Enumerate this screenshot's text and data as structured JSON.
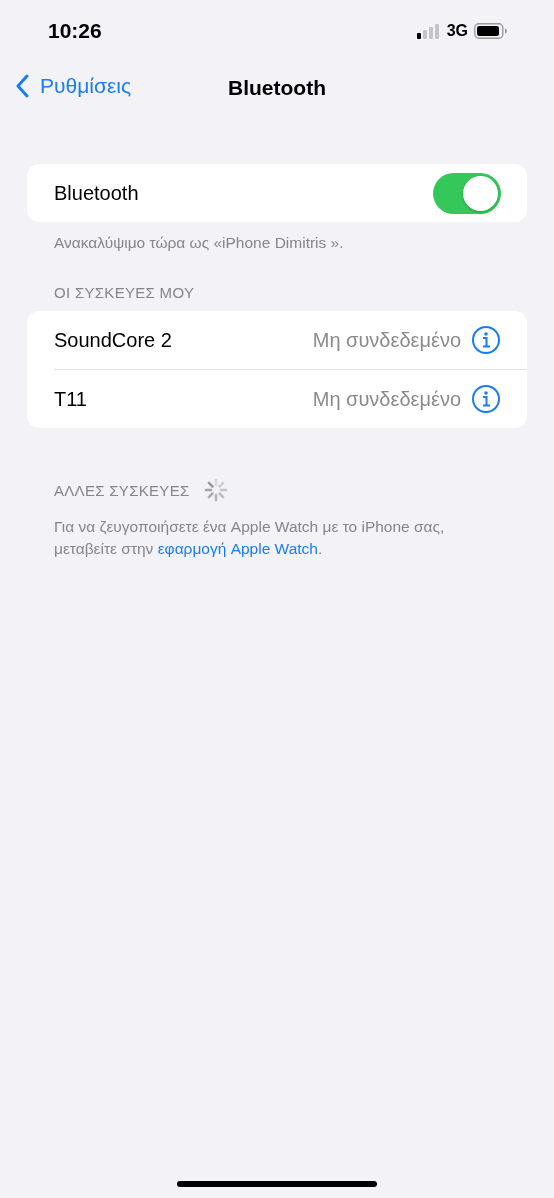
{
  "status_bar": {
    "time": "10:26",
    "network": "3G"
  },
  "nav": {
    "back": "Ρυθμίσεις",
    "title": "Bluetooth"
  },
  "bluetooth": {
    "label": "Bluetooth",
    "on": true,
    "footer": "Ανακαλύψιμο τώρα ως «iPhone Dimitris »."
  },
  "my_devices": {
    "header": "ΟΙ ΣΥΣΚΕΥΕΣ ΜΟΥ",
    "devices": [
      {
        "name": "SoundCore 2",
        "status": "Μη συνδεδεμένο"
      },
      {
        "name": "T11",
        "status": "Μη συνδεδεμένο"
      }
    ]
  },
  "other_devices": {
    "header": "ΑΛΛΕΣ ΣΥΣΚΕΥΕΣ",
    "searching": true,
    "note_before": "Για να ζευγοποιήσετε ένα Apple Watch με το iPhone σας, μεταβείτε στην ",
    "note_link": "εφαρμογή Apple Watch",
    "note_after": "."
  }
}
